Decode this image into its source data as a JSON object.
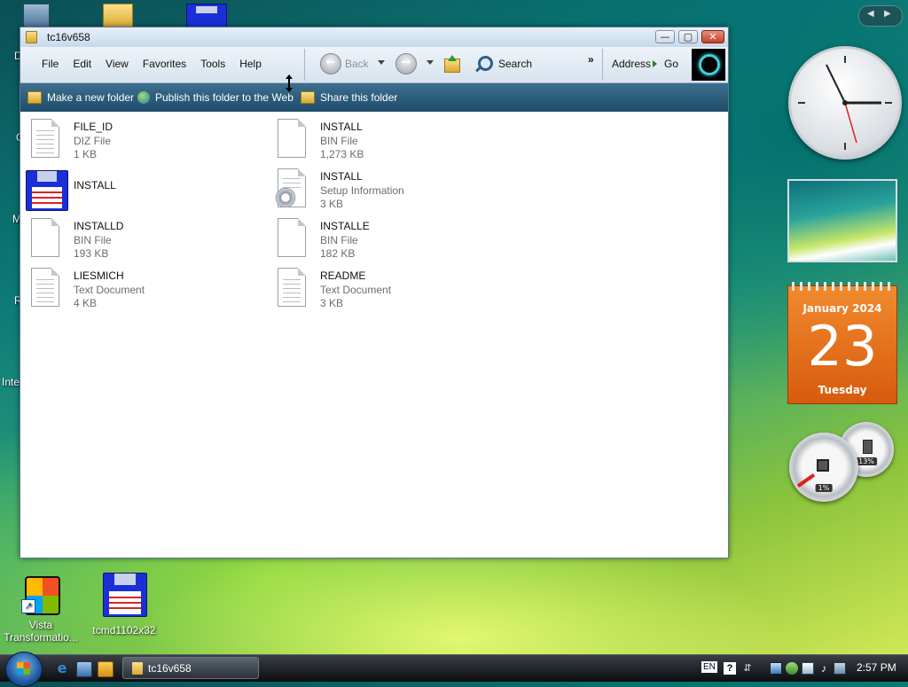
{
  "window": {
    "title": "tc16v658",
    "minimize_glyph": "—",
    "maximize_glyph": "▢",
    "close_glyph": "✕"
  },
  "menu": [
    "File",
    "Edit",
    "View",
    "Favorites",
    "Tools",
    "Help"
  ],
  "toolbar": {
    "back_label": "Back",
    "search_label": "Search",
    "address_label": "Address",
    "go_label": "Go",
    "chevron": "»"
  },
  "tasks": {
    "new_folder": "Make a new folder",
    "publish": "Publish this folder to the Web",
    "share": "Share this folder"
  },
  "files": [
    {
      "name": "FILE_ID",
      "type": "DIZ File",
      "size": "1 KB",
      "icon": "text-document-icon"
    },
    {
      "name": "INSTALL",
      "type": "BIN File",
      "size": "1,273 KB",
      "icon": "blank-file-icon"
    },
    {
      "name": "INSTALL",
      "type": "",
      "size": "",
      "icon": "floppy-disk-icon"
    },
    {
      "name": "INSTALL",
      "type": "Setup Information",
      "size": "3 KB",
      "icon": "setup-information-icon"
    },
    {
      "name": "INSTALLD",
      "type": "BIN File",
      "size": "193 KB",
      "icon": "blank-file-icon"
    },
    {
      "name": "INSTALLE",
      "type": "BIN File",
      "size": "182 KB",
      "icon": "blank-file-icon"
    },
    {
      "name": "LIESMICH",
      "type": "Text Document",
      "size": "4 KB",
      "icon": "text-document-icon"
    },
    {
      "name": "README",
      "type": "Text Document",
      "size": "3 KB",
      "icon": "text-document-icon"
    }
  ],
  "desktop": {
    "icons": [
      {
        "label": "Vista Transformatio...",
        "icon": "vista-transformation-icon"
      },
      {
        "label": "tcmd1102x32",
        "icon": "floppy-disk-icon"
      }
    ],
    "edge_chars": [
      "D",
      "C",
      "M",
      "R",
      "Inte"
    ]
  },
  "gadgets": {
    "calendar": {
      "month": "January 2024",
      "day": "23",
      "weekday": "Tuesday"
    },
    "cpu_meter": {
      "cpu_percent": "1%",
      "memory_percent": "13%"
    },
    "sidebar_prev": "◀",
    "sidebar_next": "▶"
  },
  "taskbar": {
    "task_label": "tc16v658",
    "language": "EN",
    "time": "2:57 PM"
  }
}
